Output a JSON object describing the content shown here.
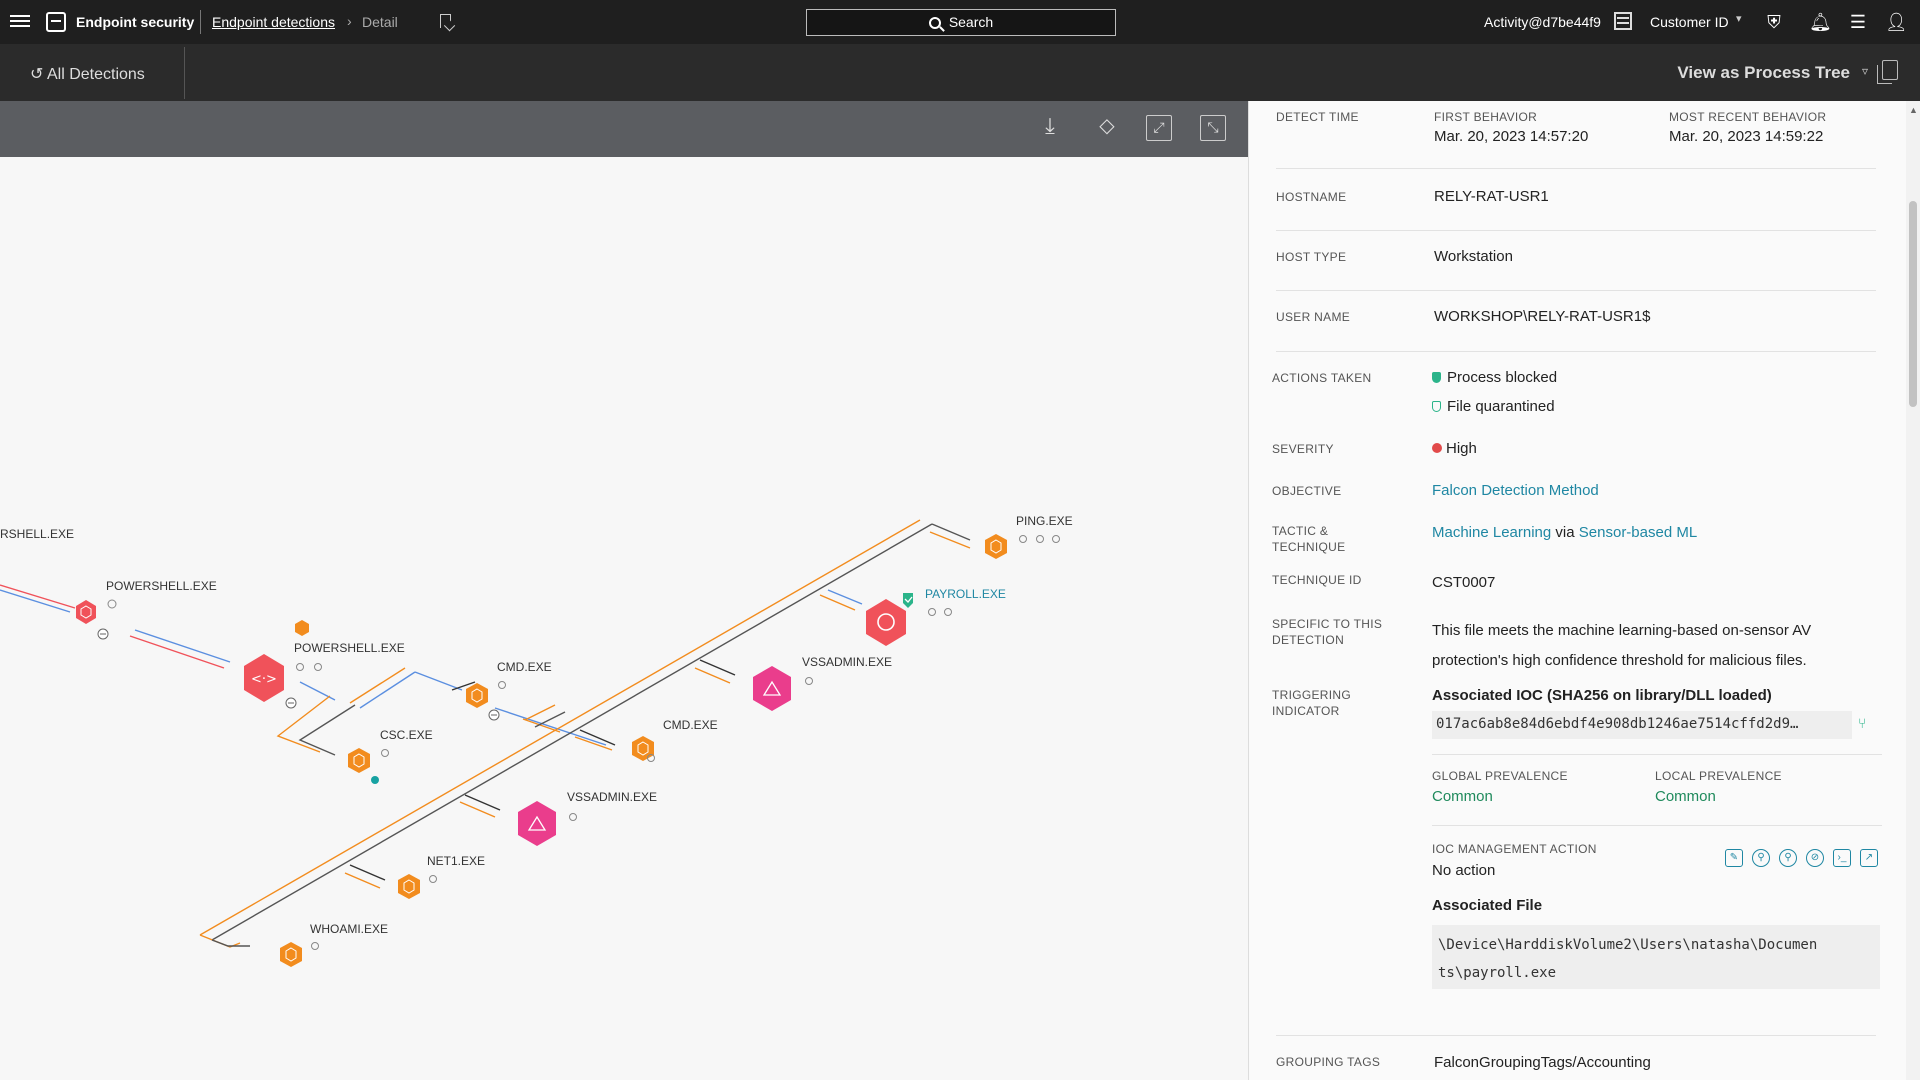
{
  "topbar": {
    "app_name": "Endpoint security",
    "breadcrumb_parent": "Endpoint detections",
    "breadcrumb_current": "Detail",
    "search_label": "Search",
    "activity": "Activity@d7be44f9",
    "customer": "Customer ID"
  },
  "subbar": {
    "back_label": "All Detections",
    "view_label": "View as Process Tree"
  },
  "graph": {
    "toolbar": [
      "download-icon",
      "layers-icon",
      "expand-icon",
      "collapse-icon"
    ],
    "nodes": [
      {
        "label": "RSHELL.EXE",
        "kind": "label-only"
      },
      {
        "label": "POWERSHELL.EXE",
        "kind": "red"
      },
      {
        "label": "POWERSHELL.EXE",
        "kind": "red-large"
      },
      {
        "label": "CMD.EXE",
        "kind": "orange"
      },
      {
        "label": "CSC.EXE",
        "kind": "orange"
      },
      {
        "label": "CMD.EXE",
        "kind": "orange"
      },
      {
        "label": "VSSADMIN.EXE",
        "kind": "pink"
      },
      {
        "label": "VSSADMIN.EXE",
        "kind": "pink"
      },
      {
        "label": "PAYROLL.EXE",
        "kind": "red-target"
      },
      {
        "label": "PING.EXE",
        "kind": "orange"
      },
      {
        "label": "NET1.EXE",
        "kind": "orange"
      },
      {
        "label": "WHOAMI.EXE",
        "kind": "orange"
      }
    ]
  },
  "details": {
    "detect_time_label": "DETECT TIME",
    "first_behavior_label": "FIRST BEHAVIOR",
    "first_behavior": "Mar. 20, 2023 14:57:20",
    "most_recent_label": "MOST RECENT BEHAVIOR",
    "most_recent": "Mar. 20, 2023 14:59:22",
    "hostname_label": "HOSTNAME",
    "hostname": "RELY-RAT-USR1",
    "host_type_label": "HOST TYPE",
    "host_type": "Workstation",
    "user_name_label": "USER NAME",
    "user_name": "WORKSHOP\\RELY-RAT-USR1$",
    "actions_label": "ACTIONS TAKEN",
    "actions": [
      "Process blocked",
      "File quarantined"
    ],
    "severity_label": "SEVERITY",
    "severity": "High",
    "objective_label": "OBJECTIVE",
    "objective": "Falcon Detection Method",
    "tactic_label_1": "TACTIC &",
    "tactic_label_2": "TECHNIQUE",
    "tactic": "Machine Learning",
    "tactic_via": "via",
    "technique": "Sensor-based ML",
    "technique_id_label": "TECHNIQUE ID",
    "technique_id": "CST0007",
    "specific_label_1": "SPECIFIC TO THIS",
    "specific_label_2": "DETECTION",
    "specific_1": "This file meets the machine learning-based on-sensor AV",
    "specific_2": "protection's high confidence threshold for malicious files.",
    "triggering_label_1": "TRIGGERING",
    "triggering_label_2": "INDICATOR",
    "ioc_title": "Associated IOC (SHA256 on library/DLL loaded)",
    "ioc_value": "017ac6ab8e84d6ebdf4e908db1246ae7514cffd2d9…",
    "global_prev_label": "GLOBAL PREVALENCE",
    "global_prev": "Common",
    "local_prev_label": "LOCAL PREVALENCE",
    "local_prev": "Common",
    "ioc_mgmt_label": "IOC MANAGEMENT ACTION",
    "ioc_mgmt": "No action",
    "assoc_file_label": "Associated File",
    "assoc_file_1": "\\Device\\HarddiskVolume2\\Users\\natasha\\Documen",
    "assoc_file_2": "ts\\payroll.exe",
    "grouping_label": "GROUPING TAGS",
    "grouping": "FalconGroupingTags/Accounting"
  },
  "colors": {
    "orange": "#f28c1e",
    "red": "#f0525a",
    "pink": "#ea3d8c",
    "blue_line": "#5b8fe0",
    "link": "#1f87a3",
    "green": "#1f8a5c",
    "shield_green": "#2bb48a"
  }
}
